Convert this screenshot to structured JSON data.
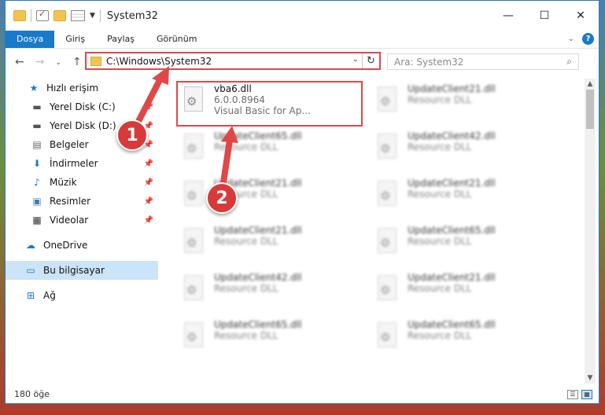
{
  "window": {
    "title": "System32",
    "controls": {
      "minimize": "—",
      "maximize": "☐",
      "close": "✕"
    }
  },
  "ribbon": {
    "tabs": [
      "Dosya",
      "Giriş",
      "Paylaş",
      "Görünüm"
    ]
  },
  "address": {
    "path": "C:\\Windows\\System32",
    "refresh_glyph": "↻"
  },
  "search": {
    "placeholder": "Ara: System32",
    "icon_glyph": "⌕"
  },
  "sidebar": {
    "items": [
      {
        "label": "Hızlı erişim",
        "icon": "star-icon"
      },
      {
        "label": "Yerel Disk (C:)",
        "icon": "drive-icon",
        "pinned": true
      },
      {
        "label": "Yerel Disk (D:)",
        "icon": "drive-icon",
        "pinned": true
      },
      {
        "label": "Belgeler",
        "icon": "documents-icon",
        "pinned": true
      },
      {
        "label": "İndirmeler",
        "icon": "download-icon",
        "pinned": true
      },
      {
        "label": "Müzik",
        "icon": "music-icon",
        "pinned": true
      },
      {
        "label": "Resimler",
        "icon": "pictures-icon",
        "pinned": true
      },
      {
        "label": "Videolar",
        "icon": "videos-icon",
        "pinned": true
      },
      {
        "label": "OneDrive",
        "icon": "cloud-icon"
      },
      {
        "label": "Bu bilgisayar",
        "icon": "computer-icon",
        "selected": true
      },
      {
        "label": "Ağ",
        "icon": "network-icon"
      }
    ]
  },
  "files": [
    {
      "name": "vba6.dll",
      "line2": "6.0.0.8964",
      "line3": "Visual Basic for Ap...",
      "highlighted": true
    },
    {
      "name": "UpdateClient21.dll",
      "line2": "Resource DLL",
      "blurred": true
    },
    {
      "name": "UpdateClient65.dll",
      "line2": "Resource DLL",
      "blurred": true
    },
    {
      "name": "UpdateClient42.dll",
      "line2": "Resource DLL",
      "blurred": true
    },
    {
      "name": "UpdateClient21.dll",
      "line2": "Resource DLL",
      "blurred": true
    },
    {
      "name": "UpdateClient21.dll",
      "line2": "Resource DLL",
      "blurred": true
    },
    {
      "name": "UpdateClient21.dll",
      "line2": "Resource DLL",
      "blurred": true
    },
    {
      "name": "UpdateClient65.dll",
      "line2": "Resource DLL",
      "blurred": true
    },
    {
      "name": "UpdateClient42.dll",
      "line2": "Resource DLL",
      "blurred": true
    },
    {
      "name": "UpdateClient21.dll",
      "line2": "Resource DLL",
      "blurred": true
    },
    {
      "name": "UpdateClient65.dll",
      "line2": "Resource DLL",
      "blurred": true
    },
    {
      "name": "UpdateClient65.dll",
      "line2": "Resource DLL",
      "blurred": true
    }
  ],
  "status": {
    "count": "180 öğe"
  },
  "annotations": {
    "step1": "1",
    "step2": "2"
  },
  "colors": {
    "accent": "#1979ca",
    "highlight": "#e04848"
  }
}
